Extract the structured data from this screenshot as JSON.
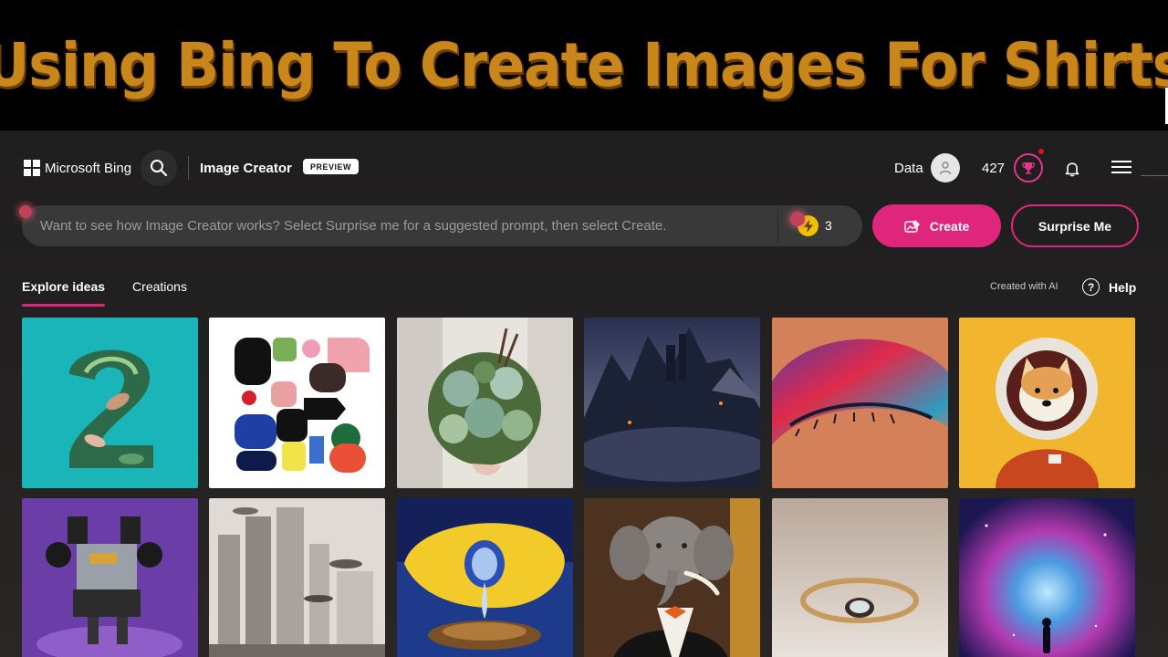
{
  "banner": {
    "title": "Using Bing To Create Images For Shirts"
  },
  "header": {
    "brand": "Microsoft Bing",
    "app_name": "Image Creator",
    "badge": "PREVIEW",
    "user_label": "Data",
    "points": "427"
  },
  "prompt": {
    "placeholder": "Want to see how Image Creator works? Select Surprise me for a suggested prompt, then select Create.",
    "value": "",
    "boosts": "3",
    "create_label": "Create",
    "surprise_label": "Surprise Me"
  },
  "tabs": [
    {
      "label": "Explore ideas",
      "active": true
    },
    {
      "label": "Creations",
      "active": false
    }
  ],
  "toolbar": {
    "ai_note": "Created with AI",
    "help_label": "Help"
  },
  "gallery": {
    "thumbnails": [
      {
        "name": "number-two-leaves",
        "bg": "#18b6b9"
      },
      {
        "name": "abstract-shapes",
        "bg": "#ffffff"
      },
      {
        "name": "succulent-bouquet",
        "bg": "#d9d6d0"
      },
      {
        "name": "dark-castle",
        "bg": "#2c3048"
      },
      {
        "name": "eye-makeup",
        "bg": "#d47f58"
      },
      {
        "name": "shiba-astronaut",
        "bg": "#f2b62e"
      },
      {
        "name": "robot-on-purple",
        "bg": "#6a3ea6"
      },
      {
        "name": "foggy-city",
        "bg": "#d8d2ce"
      },
      {
        "name": "lemon-droplet",
        "bg": "#1d3b8a"
      },
      {
        "name": "elephant-in-suit",
        "bg": "#5a3a1e"
      },
      {
        "name": "gold-ring",
        "bg": "#cdbfb2"
      },
      {
        "name": "cosmic-nebula",
        "bg": "#20215a"
      }
    ]
  },
  "colors": {
    "accent": "#e0267c",
    "boost": "#f2c200",
    "badge_dot": "#e81123"
  }
}
